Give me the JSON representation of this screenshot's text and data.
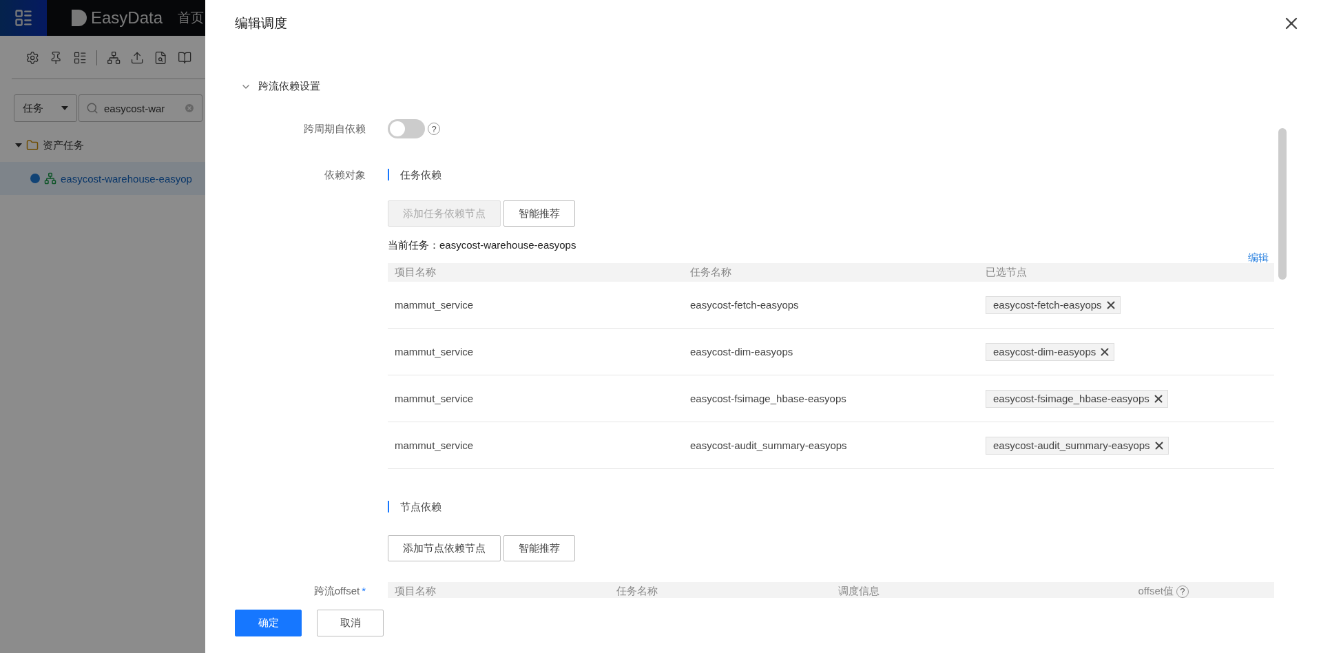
{
  "app": {
    "brand": "EasyData",
    "nav": [
      "首页"
    ],
    "filter": {
      "value": "任务"
    },
    "search": {
      "value": "easycost-war"
    },
    "tree": [
      {
        "label": "资产任务",
        "expanded": true,
        "children": [
          {
            "label": "easycost-warehouse-easyop",
            "selected": true
          }
        ]
      }
    ]
  },
  "drawer": {
    "title": "编辑调度",
    "section": {
      "title": "跨流依赖设置",
      "expanded": true
    },
    "self_dependency": {
      "label": "跨周期自依赖",
      "on": false,
      "help": "?"
    },
    "dependency_label": "依赖对象",
    "task_dependency": {
      "title": "任务依赖",
      "buttons": [
        {
          "label": "添加任务依赖节点",
          "disabled": true
        },
        {
          "label": "智能推荐",
          "disabled": false
        }
      ],
      "current_task": "当前任务：easycost-warehouse-easyops",
      "edit_link": "编辑",
      "columns": [
        "项目名称",
        "任务名称",
        "已选节点"
      ],
      "rows": [
        {
          "project": "mammut_service",
          "task": "easycost-fetch-easyops",
          "nodes": [
            "easycost-fetch-easyops"
          ]
        },
        {
          "project": "mammut_service",
          "task": "easycost-dim-easyops",
          "nodes": [
            "easycost-dim-easyops"
          ]
        },
        {
          "project": "mammut_service",
          "task": "easycost-fsimage_hbase-easyops",
          "nodes": [
            "easycost-fsimage_hbase-easyops"
          ]
        },
        {
          "project": "mammut_service",
          "task": "easycost-audit_summary-easyops",
          "nodes": [
            "easycost-audit_summary-easyops"
          ]
        }
      ]
    },
    "node_dependency": {
      "title": "节点依赖",
      "buttons": [
        {
          "label": "添加节点依赖节点",
          "disabled": false
        },
        {
          "label": "智能推荐",
          "disabled": false
        }
      ]
    },
    "offset": {
      "label": "跨流offset",
      "required": "*",
      "columns": [
        {
          "label": "项目名称"
        },
        {
          "label": "任务名称"
        },
        {
          "label": "调度信息"
        },
        {
          "label": "offset值",
          "help": "?"
        }
      ]
    },
    "footer": [
      {
        "label": "确定",
        "kind": "primary"
      },
      {
        "label": "取消",
        "kind": "default"
      }
    ]
  }
}
